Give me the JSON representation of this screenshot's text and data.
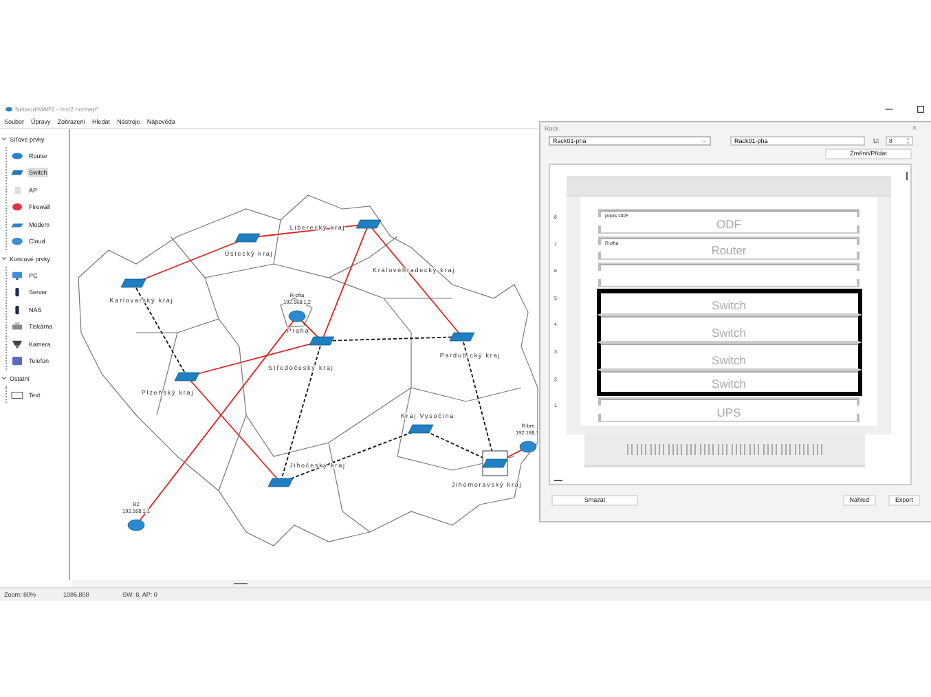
{
  "window": {
    "title": "NetworkMAP2 - test2.netmap*"
  },
  "menu": [
    "Soubor",
    "Úpravy",
    "Zobrazení",
    "Hledat",
    "Nástroje",
    "Nápověda"
  ],
  "sidebar": {
    "groups": [
      {
        "label": "Síťové prvky",
        "expanded": true,
        "children": [
          {
            "label": "Router",
            "kind": "router",
            "selected": false
          },
          {
            "label": "Switch",
            "kind": "switch",
            "selected": true
          },
          {
            "label": "AP",
            "kind": "ap",
            "selected": false
          },
          {
            "label": "Firewall",
            "kind": "firewall",
            "selected": false
          },
          {
            "label": "Modem",
            "kind": "modem",
            "selected": false
          },
          {
            "label": "Cloud",
            "kind": "cloud",
            "selected": false
          }
        ]
      },
      {
        "label": "Koncové prvky",
        "expanded": true,
        "children": [
          {
            "label": "PC",
            "kind": "pc",
            "selected": false
          },
          {
            "label": "Server",
            "kind": "server",
            "selected": false
          },
          {
            "label": "NAS",
            "kind": "nas",
            "selected": false
          },
          {
            "label": "Tiskárna",
            "kind": "printer",
            "selected": false
          },
          {
            "label": "Kamera",
            "kind": "camera",
            "selected": false
          },
          {
            "label": "Telefon",
            "kind": "phone",
            "selected": false
          }
        ]
      },
      {
        "label": "Ostatní",
        "expanded": true,
        "children": [
          {
            "label": "Text",
            "kind": "text",
            "selected": false
          }
        ]
      }
    ]
  },
  "map": {
    "regions": [
      {
        "label": "Ústecký kraj"
      },
      {
        "label": "Liberecký kraj"
      },
      {
        "label": "Karlovarský kraj"
      },
      {
        "label": "Královéhradecký kraj"
      },
      {
        "label": "Středočeský kraj"
      },
      {
        "label": "Pardubický kraj"
      },
      {
        "label": "Plzeňský kraj"
      },
      {
        "label": "Kraj Vysočina"
      },
      {
        "label": "Jihočeský kraj"
      },
      {
        "label": "Jihomoravský kraj"
      },
      {
        "label": "Praha"
      }
    ],
    "nodes": [
      {
        "kind": "switch",
        "selected": false
      },
      {
        "kind": "switch",
        "selected": false
      },
      {
        "kind": "switch",
        "selected": false
      },
      {
        "kind": "router",
        "name": "R-pha",
        "ip": "192.168.1.2",
        "selected": false
      },
      {
        "kind": "switch",
        "selected": false
      },
      {
        "kind": "switch",
        "selected": false
      },
      {
        "kind": "switch",
        "selected": false
      },
      {
        "kind": "switch",
        "selected": false
      },
      {
        "kind": "switch",
        "selected": false
      },
      {
        "kind": "switch",
        "selected": true
      },
      {
        "kind": "router",
        "name": "R-brn",
        "ip": "192.168.1.",
        "selected": false
      },
      {
        "kind": "router",
        "name": "R2",
        "ip": "192.168.1.1",
        "selected": false
      }
    ],
    "links": [
      {
        "kind": "solid"
      },
      {
        "kind": "solid"
      },
      {
        "kind": "solid"
      },
      {
        "kind": "solid"
      },
      {
        "kind": "solid"
      },
      {
        "kind": "solid"
      },
      {
        "kind": "solid"
      },
      {
        "kind": "solid"
      },
      {
        "kind": "solid"
      },
      {
        "kind": "dashed"
      },
      {
        "kind": "dashed"
      },
      {
        "kind": "dashed"
      },
      {
        "kind": "dashed"
      },
      {
        "kind": "dashed"
      },
      {
        "kind": "dashed"
      }
    ]
  },
  "rack_dialog": {
    "title": "Rack",
    "rack_select": "Rack01-pha",
    "name_field": "Rack01-pha",
    "units_label": "U:",
    "units": "8",
    "change_button": "Změnit/Přidat",
    "slots": [
      {
        "number": "8",
        "device": "ODF",
        "note": "popis ODF",
        "selected": false
      },
      {
        "number": "7",
        "device": "Router",
        "note": "R-pha",
        "selected": false
      },
      {
        "number": "6",
        "selected": false
      },
      {
        "number": "5",
        "device": "Switch",
        "selected": true
      },
      {
        "number": "4",
        "device": "Switch",
        "selected": true
      },
      {
        "number": "3",
        "device": "Switch",
        "selected": true
      },
      {
        "number": "2",
        "device": "Switch",
        "selected": true
      },
      {
        "number": "1",
        "device": "UPS",
        "selected": false
      }
    ],
    "buttons": [
      {
        "label": "Smazat"
      },
      {
        "label": "Náhled"
      },
      {
        "label": "Export"
      }
    ]
  },
  "status_bar": [
    "Zoom: 80%",
    "1086,808",
    "SW: 8, AP: 0"
  ]
}
